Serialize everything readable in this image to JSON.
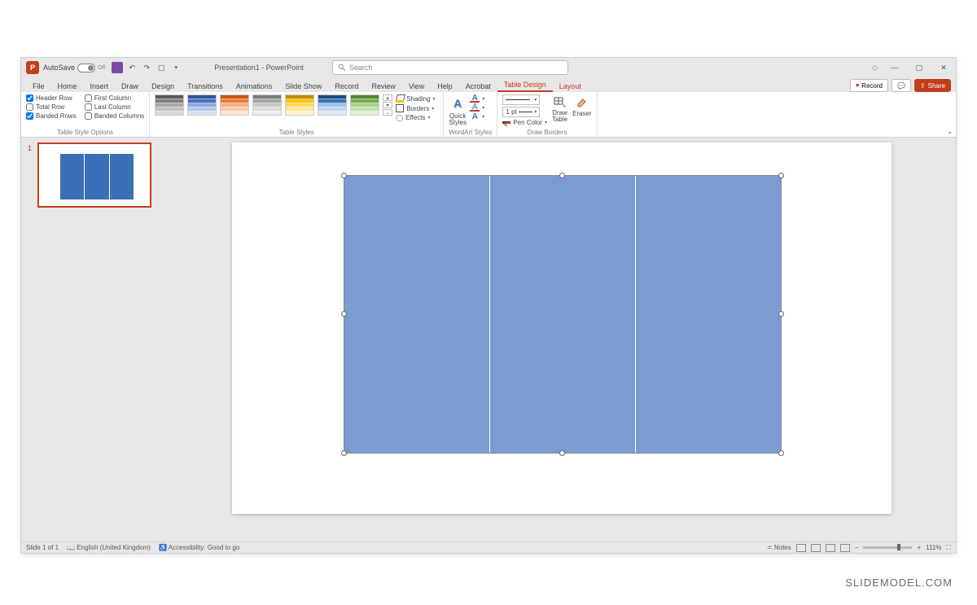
{
  "titlebar": {
    "app_initial": "P",
    "autosave_label": "AutoSave",
    "autosave_state": "Off",
    "document_title": "Presentation1 - PowerPoint",
    "search_placeholder": "Search"
  },
  "tabs": {
    "file": "File",
    "home": "Home",
    "insert": "Insert",
    "draw": "Draw",
    "design": "Design",
    "transitions": "Transitions",
    "animations": "Animations",
    "slideshow": "Slide Show",
    "record": "Record",
    "review": "Review",
    "view": "View",
    "help": "Help",
    "acrobat": "Acrobat",
    "table_design": "Table Design",
    "layout": "Layout",
    "record_btn": "Record",
    "share_btn": "Share"
  },
  "ribbon": {
    "style_options": {
      "header_row": "Header Row",
      "total_row": "Total Row",
      "banded_rows": "Banded Rows",
      "first_column": "First Column",
      "last_column": "Last Column",
      "banded_columns": "Banded Columns",
      "group": "Table Style Options",
      "checked": {
        "header_row": true,
        "total_row": false,
        "banded_rows": true,
        "first_column": false,
        "last_column": false,
        "banded_columns": false
      }
    },
    "table_styles": {
      "group": "Table Styles",
      "shading": "Shading",
      "borders": "Borders",
      "effects": "Effects"
    },
    "wordart": {
      "group": "WordArt Styles",
      "quick_styles": "Quick\nStyles"
    },
    "draw_borders": {
      "group": "Draw Borders",
      "pen_weight": "1 pt",
      "pen_color": "Pen Color",
      "draw_table": "Draw\nTable",
      "eraser": "Eraser"
    }
  },
  "thumbs": {
    "slide1_num": "1"
  },
  "status": {
    "slide_info": "Slide 1 of 1",
    "language": "English (United Kingdom)",
    "accessibility": "Accessibility: Good to go",
    "notes": "Notes",
    "zoom": "111%"
  },
  "watermark": "SLIDEMODEL.COM"
}
